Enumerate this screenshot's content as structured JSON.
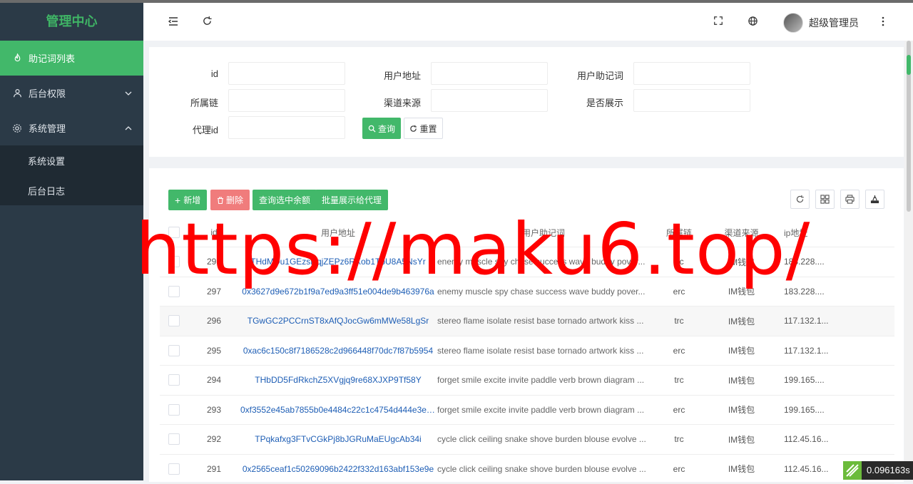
{
  "sidebar": {
    "title": "管理中心",
    "items": [
      {
        "label": "助记词列表",
        "icon": "fire-icon"
      },
      {
        "label": "后台权限",
        "icon": "user-icon"
      },
      {
        "label": "系统管理",
        "icon": "gear-icon"
      }
    ],
    "subitems": [
      {
        "label": "系统设置"
      },
      {
        "label": "后台日志"
      }
    ]
  },
  "header": {
    "username": "超级管理员"
  },
  "search": {
    "labels": {
      "id": "id",
      "address": "用户地址",
      "mnemonic": "用户助记词",
      "chain": "所属链",
      "channel": "渠道来源",
      "show": "是否展示",
      "agent": "代理id"
    },
    "query_label": "查询",
    "reset_label": "重置"
  },
  "toolbar": {
    "add_label": "新增",
    "delete_label": "删除",
    "balance_label": "查询选中余额",
    "batch_label": "批量展示给代理"
  },
  "table": {
    "columns": [
      "id",
      "用户地址",
      "用户助记词",
      "所属链",
      "渠道来源",
      "ip地址"
    ],
    "rows": [
      {
        "id": "298",
        "address": "THdMDu1GEzsNqjZEPz6RXob1TpU8A5NsYr",
        "mnemonic": "enemy muscle spy chase success wave buddy pover...",
        "chain": "trc",
        "channel": "IM钱包",
        "ip": "183.228...."
      },
      {
        "id": "297",
        "address": "0x3627d9e672b1f9a7ed9a3ff51e004de9b463976a",
        "mnemonic": "enemy muscle spy chase success wave buddy pover...",
        "chain": "erc",
        "channel": "IM钱包",
        "ip": "183.228...."
      },
      {
        "id": "296",
        "address": "TGwGC2PCCrnST8xAfQJocGw6mMWe58LgSr",
        "mnemonic": "stereo flame isolate resist base tornado artwork kiss ...",
        "chain": "trc",
        "channel": "IM钱包",
        "ip": "117.132.1..."
      },
      {
        "id": "295",
        "address": "0xac6c150c8f7186528c2d966448f70dc7f87b5954",
        "mnemonic": "stereo flame isolate resist base tornado artwork kiss ...",
        "chain": "erc",
        "channel": "IM钱包",
        "ip": "117.132.1..."
      },
      {
        "id": "294",
        "address": "THbDD5FdRkchZ5XVgjq9re68XJXP9Tf58Y",
        "mnemonic": "forget smile excite invite paddle verb brown diagram ...",
        "chain": "trc",
        "channel": "IM钱包",
        "ip": "199.165...."
      },
      {
        "id": "293",
        "address": "0xf3552e45ab7855b0e4484c22c1c4754d444e3ee0",
        "mnemonic": "forget smile excite invite paddle verb brown diagram ...",
        "chain": "erc",
        "channel": "IM钱包",
        "ip": "199.165...."
      },
      {
        "id": "292",
        "address": "TPqkafxg3FTvCGkPj8bJGRuMaEUgcAb34i",
        "mnemonic": "cycle click ceiling snake shove burden blouse evolve ...",
        "chain": "trc",
        "channel": "IM钱包",
        "ip": "112.45.16..."
      },
      {
        "id": "291",
        "address": "0x2565ceaf1c50269096b2422f332d163abf153e9e",
        "mnemonic": "cycle click ceiling snake shove burden blouse evolve ...",
        "chain": "erc",
        "channel": "IM钱包",
        "ip": "112.45.16..."
      }
    ]
  },
  "watermark": "https://maku6.top/",
  "timer": "0.096163s",
  "colors": {
    "accent": "#42b86a",
    "sidebar_bg": "#2b3a47",
    "danger": "#f07c7c",
    "link": "#1e5eb5",
    "watermark": "#ff0000"
  }
}
